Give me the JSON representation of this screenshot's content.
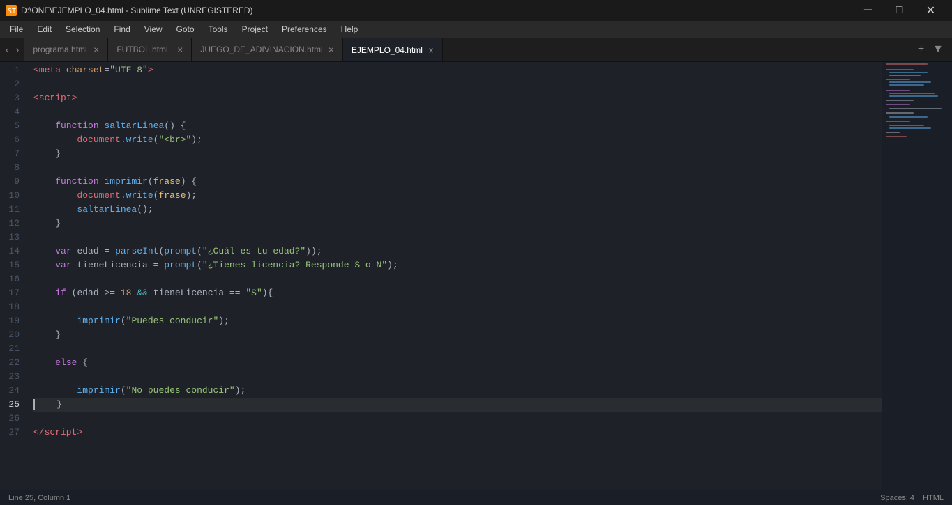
{
  "titleBar": {
    "title": "D:\\ONE\\EJEMPLO_04.html - Sublime Text (UNREGISTERED)",
    "iconText": "ST",
    "minimize": "─",
    "maximize": "□",
    "close": "✕"
  },
  "menuBar": {
    "items": [
      "File",
      "Edit",
      "Selection",
      "Find",
      "View",
      "Goto",
      "Tools",
      "Project",
      "Preferences",
      "Help"
    ]
  },
  "tabs": [
    {
      "label": "programa.html",
      "active": false
    },
    {
      "label": "FUTBOL.html",
      "active": false
    },
    {
      "label": "JUEGO_DE_ADIVINACION.html",
      "active": false
    },
    {
      "label": "EJEMPLO_04.html",
      "active": true
    }
  ],
  "statusBar": {
    "position": "Line 25, Column 1",
    "spaces": "Spaces: 4",
    "language": "HTML"
  },
  "lineNumbers": [
    1,
    2,
    3,
    4,
    5,
    6,
    7,
    8,
    9,
    10,
    11,
    12,
    13,
    14,
    15,
    16,
    17,
    18,
    19,
    20,
    21,
    22,
    23,
    24,
    25,
    26,
    27
  ],
  "currentLine": 25
}
